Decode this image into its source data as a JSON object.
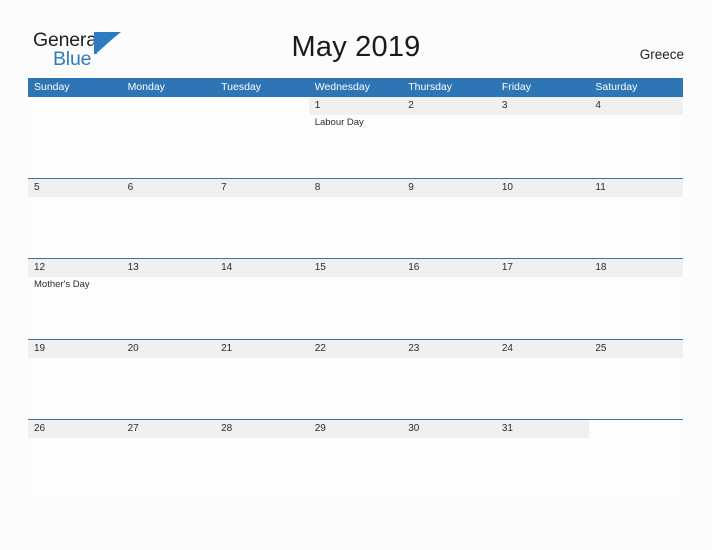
{
  "logo": {
    "word1": "General",
    "word2": "Blue",
    "triangle_icon": "triangle-icon",
    "color_dark": "#231f20",
    "color_blue": "#2d7cc0"
  },
  "header": {
    "title": "May 2019",
    "country": "Greece"
  },
  "theme": {
    "header_blue": "#2e75b6",
    "band_gray": "#f0f0f0",
    "page_bg": "#fcfcfc"
  },
  "calendar": {
    "weekdays": [
      "Sunday",
      "Monday",
      "Tuesday",
      "Wednesday",
      "Thursday",
      "Friday",
      "Saturday"
    ],
    "weeks": [
      [
        {
          "day": "",
          "event": ""
        },
        {
          "day": "",
          "event": ""
        },
        {
          "day": "",
          "event": ""
        },
        {
          "day": "1",
          "event": "Labour Day"
        },
        {
          "day": "2",
          "event": ""
        },
        {
          "day": "3",
          "event": ""
        },
        {
          "day": "4",
          "event": ""
        }
      ],
      [
        {
          "day": "5",
          "event": ""
        },
        {
          "day": "6",
          "event": ""
        },
        {
          "day": "7",
          "event": ""
        },
        {
          "day": "8",
          "event": ""
        },
        {
          "day": "9",
          "event": ""
        },
        {
          "day": "10",
          "event": ""
        },
        {
          "day": "11",
          "event": ""
        }
      ],
      [
        {
          "day": "12",
          "event": "Mother's Day"
        },
        {
          "day": "13",
          "event": ""
        },
        {
          "day": "14",
          "event": ""
        },
        {
          "day": "15",
          "event": ""
        },
        {
          "day": "16",
          "event": ""
        },
        {
          "day": "17",
          "event": ""
        },
        {
          "day": "18",
          "event": ""
        }
      ],
      [
        {
          "day": "19",
          "event": ""
        },
        {
          "day": "20",
          "event": ""
        },
        {
          "day": "21",
          "event": ""
        },
        {
          "day": "22",
          "event": ""
        },
        {
          "day": "23",
          "event": ""
        },
        {
          "day": "24",
          "event": ""
        },
        {
          "day": "25",
          "event": ""
        }
      ],
      [
        {
          "day": "26",
          "event": ""
        },
        {
          "day": "27",
          "event": ""
        },
        {
          "day": "28",
          "event": ""
        },
        {
          "day": "29",
          "event": ""
        },
        {
          "day": "30",
          "event": ""
        },
        {
          "day": "31",
          "event": ""
        },
        {
          "day": "",
          "event": ""
        }
      ]
    ]
  }
}
